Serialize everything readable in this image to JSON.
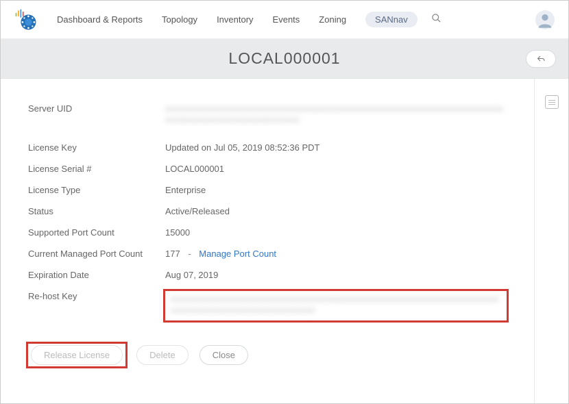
{
  "nav": {
    "items": [
      "Dashboard & Reports",
      "Topology",
      "Inventory",
      "Events",
      "Zoning"
    ],
    "active": "SANnav"
  },
  "page": {
    "title": "LOCAL000001"
  },
  "fields": {
    "serverUid": {
      "label": "Server UID",
      "value": "■■■■■■■■■■■■■■■■■■■■■■■■■■■■■■■■■■■■■■■■■■■■■■■■■■■■■■■■■■■■■■■■■■■■■■■■■■■■■■■■■■■■■■■■■■■■■■■"
    },
    "licenseKey": {
      "label": "License Key",
      "value": "Updated on Jul 05, 2019 08:52:36 PDT"
    },
    "licenseSerial": {
      "label": "License Serial #",
      "value": "LOCAL000001"
    },
    "licenseType": {
      "label": "License Type",
      "value": "Enterprise"
    },
    "status": {
      "label": "Status",
      "value": "Active/Released"
    },
    "supportedPortCount": {
      "label": "Supported Port Count",
      "value": "15000"
    },
    "currentManagedPortCount": {
      "label": "Current Managed Port Count",
      "value": "177",
      "linkText": "Manage Port Count"
    },
    "expirationDate": {
      "label": "Expiration Date",
      "value": "Aug 07, 2019"
    },
    "rehostKey": {
      "label": "Re-host Key",
      "value": "■■■■■■■■■■■■■■■■■■■■■■■■■■■■■■■■■■■■■■■■■■■■■■■■■■■■■■■■■■■■■■■■■■■■■■■■■■■■■■■■■■■■■■■■■■■■■■■"
    }
  },
  "buttons": {
    "release": "Release License",
    "delete": "Delete",
    "close": "Close"
  }
}
